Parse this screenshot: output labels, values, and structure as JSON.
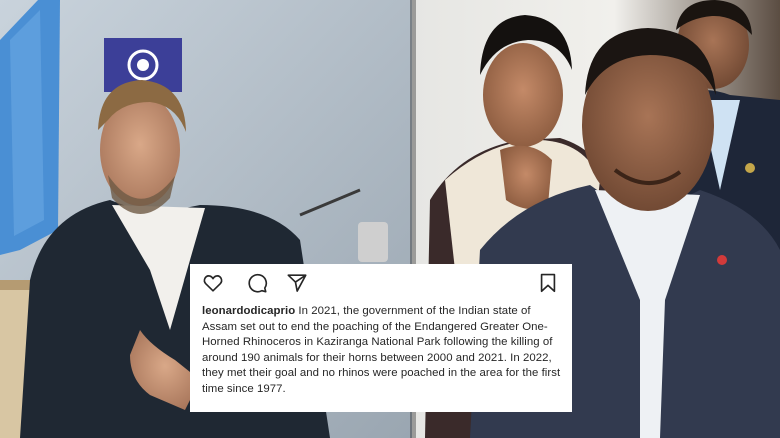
{
  "post": {
    "username": "leonardodicaprio",
    "caption": " In 2021, the government of the Indian state of Assam set out to end the poaching of the Endangered Greater One-Horned Rhinoceros in Kaziranga National Park following the killing of around 190 animals for their horns between 2000 and 2021. In 2022, they met their goal and no rhinos were poached in the area for the first time since 1977."
  },
  "icons": {
    "like": "heart-icon",
    "comment": "comment-icon",
    "share": "paper-plane-icon",
    "save": "bookmark-icon"
  },
  "colors": {
    "card_bg": "#ffffff",
    "text": "#262626",
    "un_flag": "#4a8fd4",
    "banner": "#3c3f98"
  }
}
